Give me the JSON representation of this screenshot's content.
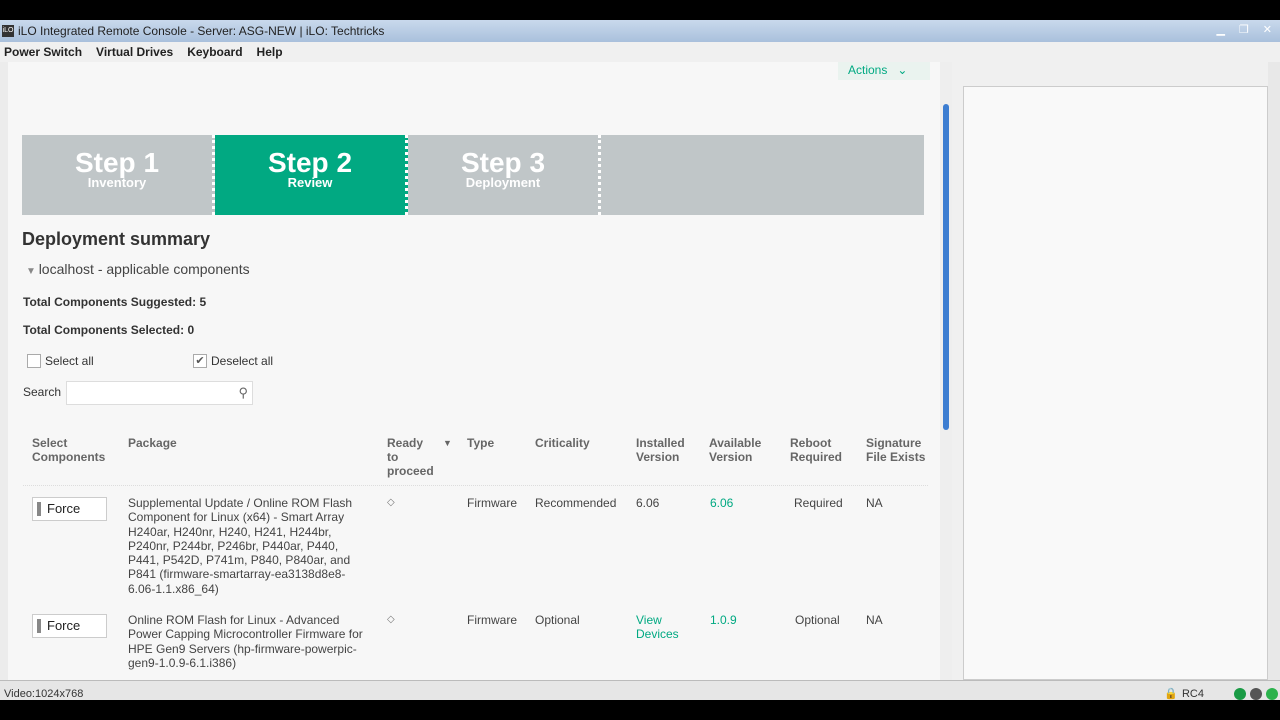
{
  "window": {
    "title": "iLO Integrated Remote Console - Server: ASG-NEW | iLO: Techtricks",
    "icon_text": "iLO"
  },
  "menu": [
    "Power Switch",
    "Virtual Drives",
    "Keyboard",
    "Help"
  ],
  "actions_label": "Actions",
  "steps": [
    {
      "num": "Step 1",
      "label": "Inventory",
      "active": false
    },
    {
      "num": "Step 2",
      "label": "Review",
      "active": true
    },
    {
      "num": "Step 3",
      "label": "Deployment",
      "active": false
    }
  ],
  "summary": {
    "title": "Deployment summary",
    "host": "localhost - applicable components",
    "suggested": "Total Components Suggested: 5",
    "selected": "Total Components Selected: 0",
    "select_all": "Select all",
    "deselect_all": "Deselect all",
    "search_label": "Search",
    "search_value": ""
  },
  "columns": [
    "Select Components",
    "Package",
    "Ready to proceed",
    "Type",
    "Criticality",
    "Installed Version",
    "Available Version",
    "Reboot Required",
    "Signature File Exists"
  ],
  "rows": [
    {
      "button": "Force",
      "package": "Supplemental Update / Online ROM Flash Component for Linux (x64) - Smart Array H240ar, H240nr, H240, H241, H244br, P240nr, P244br, P246br, P440ar, P440, P441, P542D, P741m, P840, P840ar, and P841 (firmware-smartarray-ea3138d8e8-6.06-1.1.x86_64)",
      "type": "Firmware",
      "criticality": "Recommended",
      "installed": "6.06",
      "available": "6.06",
      "reboot": "Required",
      "signature": "NA"
    },
    {
      "button": "Force",
      "package": "Online ROM Flash for Linux - Advanced Power Capping Microcontroller Firmware for HPE Gen9 Servers (hp-firmware-powerpic-gen9-1.0.9-6.1.i386)",
      "type": "Firmware",
      "criticality": "Optional",
      "installed": "View Devices",
      "available": "1.0.9",
      "reboot": "Optional",
      "signature": "NA"
    }
  ],
  "status": {
    "video": "Video:1024x768",
    "cipher": "RC4"
  },
  "colors": {
    "accent": "#01a982",
    "scroll_thumb": "#3c7dd1"
  }
}
